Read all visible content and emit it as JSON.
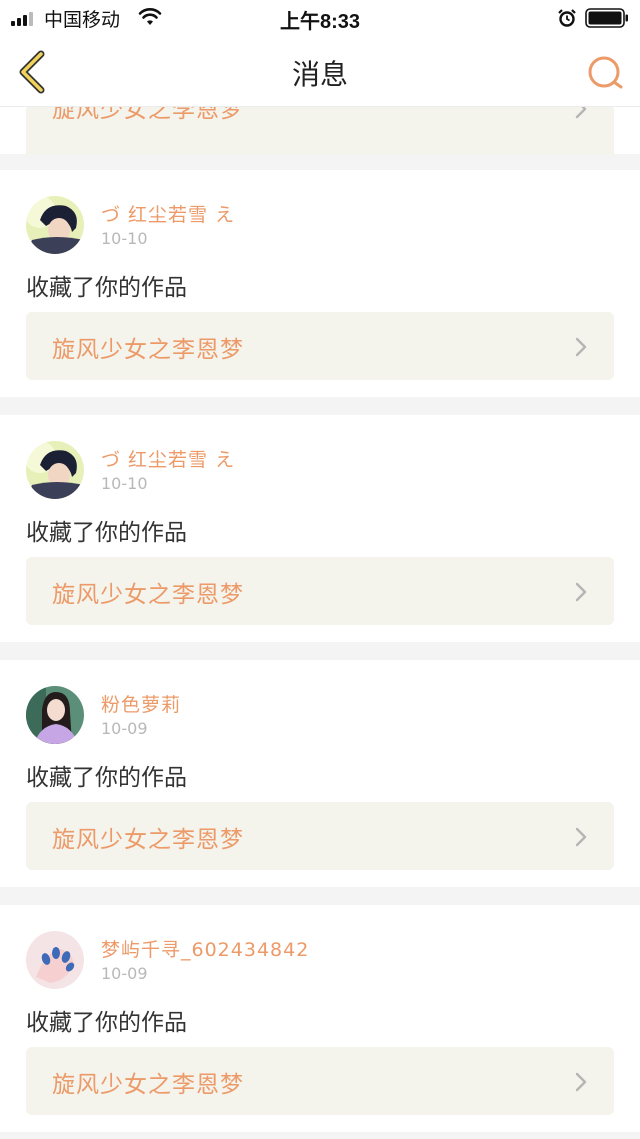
{
  "status_bar": {
    "carrier": "中国移动",
    "time": "上午8:33"
  },
  "nav": {
    "title": "消息"
  },
  "partial_item": {
    "work_title": "旋风少女之李恩梦"
  },
  "messages": [
    {
      "username": "づ 红尘若雪 え",
      "date": "10-10",
      "action": "收藏了你的作品",
      "work_title": "旋风少女之李恩梦",
      "avatar": "avatar-boy"
    },
    {
      "username": "づ 红尘若雪 え",
      "date": "10-10",
      "action": "收藏了你的作品",
      "work_title": "旋风少女之李恩梦",
      "avatar": "avatar-boy"
    },
    {
      "username": "粉色萝莉",
      "date": "10-09",
      "action": "收藏了你的作品",
      "work_title": "旋风少女之李恩梦",
      "avatar": "avatar-girl"
    },
    {
      "username": "梦屿千寻_602434842",
      "date": "10-09",
      "action": "收藏了你的作品",
      "work_title": "旋风少女之李恩梦",
      "avatar": "avatar-nails"
    }
  ],
  "colors": {
    "accent": "#ec9a68",
    "link_bg": "#f4f3ec",
    "page_bg": "#f4f4f4"
  }
}
